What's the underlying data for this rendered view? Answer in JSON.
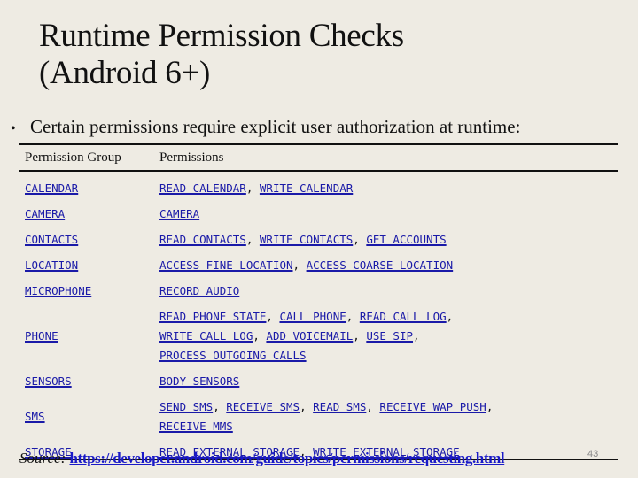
{
  "slide": {
    "title_line1": "Runtime Permission Checks",
    "title_line2": "(Android 6+)",
    "bullet_symbol": "•",
    "bullet_text": "Certain permissions require explicit user authorization at runtime:",
    "page_number": "43",
    "colors": {
      "background": "#EEEBE3",
      "link": "#1A1AA8",
      "text": "#111111"
    }
  },
  "table": {
    "headers": [
      "Permission Group",
      "Permissions"
    ],
    "rows": [
      {
        "group": "CALENDAR",
        "permissions": [
          "READ_CALENDAR",
          "WRITE_CALENDAR"
        ]
      },
      {
        "group": "CAMERA",
        "permissions": [
          "CAMERA"
        ]
      },
      {
        "group": "CONTACTS",
        "permissions": [
          "READ_CONTACTS",
          "WRITE_CONTACTS",
          "GET_ACCOUNTS"
        ]
      },
      {
        "group": "LOCATION",
        "permissions": [
          "ACCESS_FINE_LOCATION",
          "ACCESS_COARSE_LOCATION"
        ]
      },
      {
        "group": "MICROPHONE",
        "permissions": [
          "RECORD_AUDIO"
        ]
      },
      {
        "group": "PHONE",
        "permissions": [
          "READ_PHONE_STATE",
          "CALL_PHONE",
          "READ_CALL_LOG",
          "WRITE_CALL_LOG",
          "ADD_VOICEMAIL",
          "USE_SIP",
          "PROCESS_OUTGOING_CALLS"
        ]
      },
      {
        "group": "SENSORS",
        "permissions": [
          "BODY_SENSORS"
        ]
      },
      {
        "group": "SMS",
        "permissions": [
          "SEND_SMS",
          "RECEIVE_SMS",
          "READ_SMS",
          "RECEIVE_WAP_PUSH",
          "RECEIVE_MMS"
        ]
      },
      {
        "group": "STORAGE",
        "permissions": [
          "READ_EXTERNAL_STORAGE",
          "WRITE_EXTERNAL_STORAGE"
        ]
      }
    ]
  },
  "source": {
    "label": "Source:",
    "url": "https://developer.android.com/guide/topics/permissions/requesting.html"
  }
}
